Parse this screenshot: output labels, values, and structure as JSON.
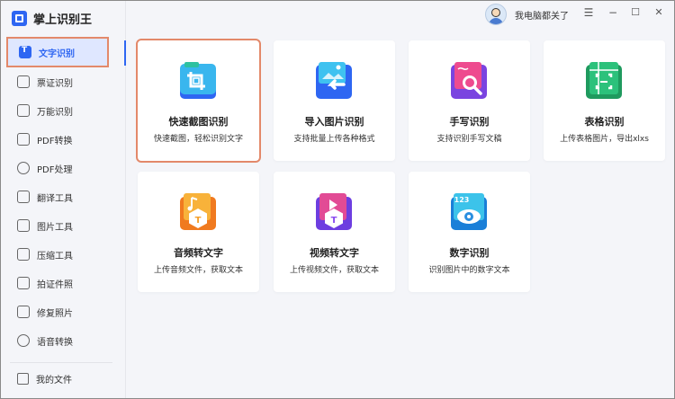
{
  "app": {
    "name": "掌上识别王"
  },
  "header": {
    "username": "我电脑都关了",
    "controls": {
      "menu": "☰",
      "minimize": "−",
      "maximize": "☐",
      "close": "✕"
    }
  },
  "sidebar": {
    "items": [
      {
        "label": "文字识别",
        "icon": "text-recognition-icon",
        "active": true
      },
      {
        "label": "票证识别",
        "icon": "ticket-icon"
      },
      {
        "label": "万能识别",
        "icon": "camera-icon"
      },
      {
        "label": "PDF转换",
        "icon": "pdf-convert-icon"
      },
      {
        "label": "PDF处理",
        "icon": "pdf-process-icon"
      },
      {
        "label": "翻译工具",
        "icon": "translate-icon"
      },
      {
        "label": "图片工具",
        "icon": "image-icon"
      },
      {
        "label": "压缩工具",
        "icon": "compress-icon"
      },
      {
        "label": "拍证件照",
        "icon": "id-photo-icon"
      },
      {
        "label": "修复照片",
        "icon": "repair-photo-icon"
      },
      {
        "label": "语音转换",
        "icon": "voice-icon"
      }
    ],
    "my_files": "我的文件"
  },
  "cards": [
    {
      "title": "快速截图识别",
      "desc": "快速截图，轻松识别文字",
      "icon": "screenshot-crop-icon",
      "color": "#2aa6e8"
    },
    {
      "title": "导入图片识别",
      "desc": "支持批量上传各种格式",
      "icon": "import-image-icon",
      "color": "#2e6ff2"
    },
    {
      "title": "手写识别",
      "desc": "支持识别手写文稿",
      "icon": "handwriting-icon",
      "color": "#e04a8a"
    },
    {
      "title": "表格识别",
      "desc": "上传表格图片，导出xlxs",
      "icon": "table-scan-icon",
      "color": "#23b26c"
    },
    {
      "title": "音频转文字",
      "desc": "上传音频文件，获取文本",
      "icon": "audio-to-text-icon",
      "color": "#f0922a"
    },
    {
      "title": "视频转文字",
      "desc": "上传视频文件，获取文本",
      "icon": "video-to-text-icon",
      "color": "#8a4cf0"
    },
    {
      "title": "数字识别",
      "desc": "识别图片中的数字文本",
      "icon": "number-recognition-icon",
      "color": "#1aa6d8"
    }
  ]
}
